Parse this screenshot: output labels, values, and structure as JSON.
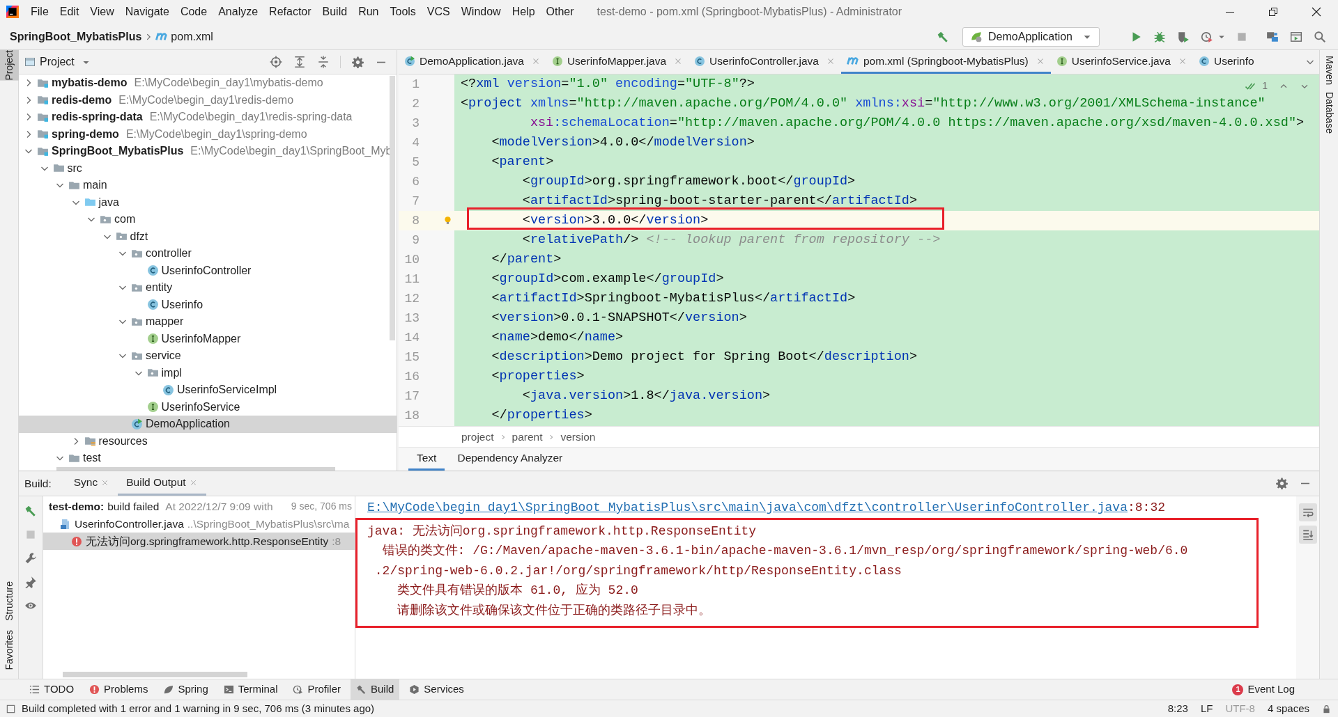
{
  "title_bar": {
    "menu": [
      "File",
      "Edit",
      "View",
      "Navigate",
      "Code",
      "Analyze",
      "Refactor",
      "Build",
      "Run",
      "Tools",
      "VCS",
      "Window",
      "Help",
      "Other"
    ],
    "title": "test-demo - pom.xml (Springboot-MybatisPlus) - Administrator"
  },
  "nav_bar": {
    "project": "SpringBoot_MybatisPlus",
    "file": "pom.xml",
    "run_config": "DemoApplication"
  },
  "left_strip": {
    "top": [
      {
        "label": "Project",
        "selected": true
      }
    ],
    "bottom": [
      {
        "label": "Structure",
        "selected": false
      },
      {
        "label": "Favorites",
        "selected": false
      }
    ]
  },
  "right_strip": [
    {
      "label": "Maven",
      "selected": false
    },
    {
      "label": "Database",
      "selected": false
    }
  ],
  "project_panel": {
    "title": "Project",
    "tree": [
      {
        "label": "mybatis-demo",
        "path": "E:\\MyCode\\begin_day1\\mybatis-demo",
        "kind": "module",
        "expanded": false,
        "selected": false
      },
      {
        "label": "redis-demo",
        "path": "E:\\MyCode\\begin_day1\\redis-demo",
        "kind": "module",
        "expanded": false,
        "selected": false
      },
      {
        "label": "redis-spring-data",
        "path": "E:\\MyCode\\begin_day1\\redis-spring-data",
        "kind": "module",
        "expanded": false,
        "selected": false
      },
      {
        "label": "spring-demo",
        "path": "E:\\MyCode\\begin_day1\\spring-demo",
        "kind": "module",
        "expanded": false,
        "selected": false
      },
      {
        "label": "SpringBoot_MybatisPlus",
        "path": "E:\\MyCode\\begin_day1\\SpringBoot_Myb",
        "kind": "module",
        "expanded": true,
        "selected": false,
        "children": [
          {
            "label": "src",
            "kind": "folder",
            "expanded": true,
            "selected": false,
            "children": [
              {
                "label": "main",
                "kind": "folder",
                "expanded": true,
                "selected": false,
                "children": [
                  {
                    "label": "java",
                    "kind": "source",
                    "expanded": true,
                    "selected": false,
                    "children": [
                      {
                        "label": "com",
                        "kind": "package",
                        "expanded": true,
                        "selected": false,
                        "children": [
                          {
                            "label": "dfzt",
                            "kind": "package",
                            "expanded": true,
                            "selected": false,
                            "children": [
                              {
                                "label": "controller",
                                "kind": "package",
                                "expanded": true,
                                "selected": false,
                                "children": [
                                  {
                                    "label": "UserinfoController",
                                    "kind": "class",
                                    "selected": false
                                  }
                                ]
                              },
                              {
                                "label": "entity",
                                "kind": "package",
                                "expanded": true,
                                "selected": false,
                                "children": [
                                  {
                                    "label": "Userinfo",
                                    "kind": "class",
                                    "selected": false
                                  }
                                ]
                              },
                              {
                                "label": "mapper",
                                "kind": "package",
                                "expanded": true,
                                "selected": false,
                                "children": [
                                  {
                                    "label": "UserinfoMapper",
                                    "kind": "interface",
                                    "selected": false
                                  }
                                ]
                              },
                              {
                                "label": "service",
                                "kind": "package",
                                "expanded": true,
                                "selected": false,
                                "children": [
                                  {
                                    "label": "impl",
                                    "kind": "package",
                                    "expanded": true,
                                    "selected": false,
                                    "children": [
                                      {
                                        "label": "UserinfoServiceImpl",
                                        "kind": "class",
                                        "selected": false
                                      }
                                    ]
                                  },
                                  {
                                    "label": "UserinfoService",
                                    "kind": "interface",
                                    "selected": false
                                  }
                                ]
                              },
                              {
                                "label": "DemoApplication",
                                "kind": "app",
                                "selected": true
                              }
                            ]
                          }
                        ]
                      }
                    ]
                  },
                  {
                    "label": "resources",
                    "kind": "resources",
                    "expanded": false,
                    "selected": false
                  }
                ]
              },
              {
                "label": "test",
                "kind": "folder",
                "expanded": true,
                "selected": false
              }
            ]
          }
        ]
      }
    ]
  },
  "editor": {
    "tabs": [
      {
        "label": "DemoApplication.java",
        "kind": "app",
        "selected": false,
        "closable": true
      },
      {
        "label": "UserinfoMapper.java",
        "kind": "interface",
        "selected": false,
        "closable": true
      },
      {
        "label": "UserinfoController.java",
        "kind": "class",
        "selected": false,
        "closable": true
      },
      {
        "label": "pom.xml (Springboot-MybatisPlus)",
        "kind": "maven",
        "selected": true,
        "closable": true
      },
      {
        "label": "UserinfoService.java",
        "kind": "interface",
        "selected": false,
        "closable": true
      },
      {
        "label": "Userinfo",
        "kind": "class",
        "selected": false,
        "closable": false
      }
    ],
    "inspection_count": "1",
    "lines": [
      {
        "number": "1",
        "highlighted": false,
        "tokens": [
          {
            "kind": "plain",
            "text": "<?"
          },
          {
            "kind": "tag",
            "text": "xml"
          },
          {
            "kind": "attr",
            "text": " version"
          },
          {
            "kind": "plain",
            "text": "="
          },
          {
            "kind": "value",
            "text": "\"1.0\""
          },
          {
            "kind": "attr",
            "text": " encoding"
          },
          {
            "kind": "plain",
            "text": "="
          },
          {
            "kind": "value",
            "text": "\"UTF-8\""
          },
          {
            "kind": "plain",
            "text": "?>"
          }
        ]
      },
      {
        "number": "2",
        "highlighted": false,
        "tokens": [
          {
            "kind": "plain",
            "text": "<"
          },
          {
            "kind": "tag",
            "text": "project"
          },
          {
            "kind": "attr",
            "text": " xmlns"
          },
          {
            "kind": "plain",
            "text": "="
          },
          {
            "kind": "value",
            "text": "\"http://maven.apache.org/POM/4.0.0\""
          },
          {
            "kind": "attr",
            "text": " xmlns:"
          },
          {
            "kind": "ns",
            "text": "xsi"
          },
          {
            "kind": "plain",
            "text": "="
          },
          {
            "kind": "value",
            "text": "\"http://www.w3.org/2001/XMLSchema-instance\""
          }
        ]
      },
      {
        "number": "3",
        "highlighted": false,
        "tokens": [
          {
            "kind": "ns",
            "text": "         xsi"
          },
          {
            "kind": "attr",
            "text": ":schemaLocation"
          },
          {
            "kind": "plain",
            "text": "="
          },
          {
            "kind": "value",
            "text": "\"http://maven.apache.org/POM/4.0.0 https://maven.apache.org/xsd/maven-4.0.0.xsd\""
          },
          {
            "kind": "plain",
            "text": ">"
          }
        ]
      },
      {
        "number": "4",
        "highlighted": false,
        "tokens": [
          {
            "kind": "plain",
            "text": "    <"
          },
          {
            "kind": "tag",
            "text": "modelVersion"
          },
          {
            "kind": "plain",
            "text": ">4.0.0</"
          },
          {
            "kind": "tag",
            "text": "modelVersion"
          },
          {
            "kind": "plain",
            "text": ">"
          }
        ]
      },
      {
        "number": "5",
        "highlighted": false,
        "tokens": [
          {
            "kind": "plain",
            "text": "    <"
          },
          {
            "kind": "tag",
            "text": "parent"
          },
          {
            "kind": "plain",
            "text": ">"
          }
        ]
      },
      {
        "number": "6",
        "highlighted": false,
        "tokens": [
          {
            "kind": "plain",
            "text": "        <"
          },
          {
            "kind": "tag",
            "text": "groupId"
          },
          {
            "kind": "plain",
            "text": ">org.springframework.boot</"
          },
          {
            "kind": "tag",
            "text": "groupId"
          },
          {
            "kind": "plain",
            "text": ">"
          }
        ]
      },
      {
        "number": "7",
        "highlighted": false,
        "tokens": [
          {
            "kind": "plain",
            "text": "        <"
          },
          {
            "kind": "tag",
            "text": "artifactId"
          },
          {
            "kind": "plain",
            "text": ">spring-boot-starter-parent</"
          },
          {
            "kind": "tag",
            "text": "artifactId"
          },
          {
            "kind": "plain",
            "text": ">"
          }
        ]
      },
      {
        "number": "8",
        "highlighted": true,
        "tokens": [
          {
            "kind": "plain",
            "text": "        <"
          },
          {
            "kind": "tag",
            "text": "version"
          },
          {
            "kind": "plain",
            "text": ">3.0.0</"
          },
          {
            "kind": "tag",
            "text": "version"
          },
          {
            "kind": "plain",
            "text": ">"
          }
        ]
      },
      {
        "number": "9",
        "highlighted": false,
        "tokens": [
          {
            "kind": "plain",
            "text": "        <"
          },
          {
            "kind": "tag",
            "text": "relativePath"
          },
          {
            "kind": "plain",
            "text": "/> "
          },
          {
            "kind": "comment",
            "text": "<!-- lookup parent from repository -->"
          }
        ]
      },
      {
        "number": "10",
        "highlighted": false,
        "tokens": [
          {
            "kind": "plain",
            "text": "    </"
          },
          {
            "kind": "tag",
            "text": "parent"
          },
          {
            "kind": "plain",
            "text": ">"
          }
        ]
      },
      {
        "number": "11",
        "highlighted": false,
        "tokens": [
          {
            "kind": "plain",
            "text": "    <"
          },
          {
            "kind": "tag",
            "text": "groupId"
          },
          {
            "kind": "plain",
            "text": ">com.example</"
          },
          {
            "kind": "tag",
            "text": "groupId"
          },
          {
            "kind": "plain",
            "text": ">"
          }
        ]
      },
      {
        "number": "12",
        "highlighted": false,
        "tokens": [
          {
            "kind": "plain",
            "text": "    <"
          },
          {
            "kind": "tag",
            "text": "artifactId"
          },
          {
            "kind": "plain",
            "text": ">Springboot-MybatisPlus</"
          },
          {
            "kind": "tag",
            "text": "artifactId"
          },
          {
            "kind": "plain",
            "text": ">"
          }
        ]
      },
      {
        "number": "13",
        "highlighted": false,
        "tokens": [
          {
            "kind": "plain",
            "text": "    <"
          },
          {
            "kind": "tag",
            "text": "version"
          },
          {
            "kind": "plain",
            "text": ">0.0.1-SNAPSHOT</"
          },
          {
            "kind": "tag",
            "text": "version"
          },
          {
            "kind": "plain",
            "text": ">"
          }
        ]
      },
      {
        "number": "14",
        "highlighted": false,
        "tokens": [
          {
            "kind": "plain",
            "text": "    <"
          },
          {
            "kind": "tag",
            "text": "name"
          },
          {
            "kind": "plain",
            "text": ">demo</"
          },
          {
            "kind": "tag",
            "text": "name"
          },
          {
            "kind": "plain",
            "text": ">"
          }
        ]
      },
      {
        "number": "15",
        "highlighted": false,
        "tokens": [
          {
            "kind": "plain",
            "text": "    <"
          },
          {
            "kind": "tag",
            "text": "description"
          },
          {
            "kind": "plain",
            "text": ">Demo project for Spring Boot</"
          },
          {
            "kind": "tag",
            "text": "description"
          },
          {
            "kind": "plain",
            "text": ">"
          }
        ]
      },
      {
        "number": "16",
        "highlighted": false,
        "tokens": [
          {
            "kind": "plain",
            "text": "    <"
          },
          {
            "kind": "tag",
            "text": "properties"
          },
          {
            "kind": "plain",
            "text": ">"
          }
        ]
      },
      {
        "number": "17",
        "highlighted": false,
        "tokens": [
          {
            "kind": "plain",
            "text": "        <"
          },
          {
            "kind": "tag",
            "text": "java.version"
          },
          {
            "kind": "plain",
            "text": ">1.8</"
          },
          {
            "kind": "tag",
            "text": "java.version"
          },
          {
            "kind": "plain",
            "text": ">"
          }
        ]
      },
      {
        "number": "18",
        "highlighted": false,
        "tokens": [
          {
            "kind": "plain",
            "text": "    </"
          },
          {
            "kind": "tag",
            "text": "properties"
          },
          {
            "kind": "plain",
            "text": ">"
          }
        ]
      }
    ],
    "breadcrumb": [
      "project",
      "parent",
      "version"
    ],
    "view_tabs": [
      {
        "label": "Text",
        "selected": true
      },
      {
        "label": "Dependency Analyzer",
        "selected": false
      }
    ]
  },
  "build": {
    "label": "Build:",
    "tabs": [
      {
        "label": "Sync",
        "selected": false
      },
      {
        "label": "Build Output",
        "selected": true
      }
    ],
    "tree": [
      {
        "kind": "summary",
        "title": "test-demo:",
        "status": "build failed",
        "time": "At 2022/12/7 9:09 with",
        "duration": "9 sec, 706 ms",
        "selected": false,
        "children": [
          {
            "kind": "file",
            "label": "UserinfoController.java",
            "path": "..\\SpringBoot_MybatisPlus\\src\\ma",
            "selected": false,
            "children": [
              {
                "kind": "error",
                "label": "无法访问org.springframework.http.ResponseEntity",
                "suffix": ":8",
                "selected": true
              }
            ]
          }
        ]
      }
    ],
    "console": {
      "link": "E:\\MyCode\\begin_day1\\SpringBoot_MybatisPlus\\src\\main\\java\\com\\dfzt\\controller\\UserinfoController.java",
      "link_suffix": ":8:32",
      "lines": [
        "java: 无法访问org.springframework.http.ResponseEntity",
        "  错误的类文件: /G:/Maven/apache-maven-3.6.1-bin/apache-maven-3.6.1/mvn_resp/org/springframework/spring-web/6.0",
        " .2/spring-web-6.0.2.jar!/org/springframework/http/ResponseEntity.class",
        "    类文件具有错误的版本 61.0, 应为 52.0",
        "    请删除该文件或确保该文件位于正确的类路径子目录中。"
      ]
    }
  },
  "tool_windows": [
    {
      "label": "TODO",
      "kind": "list",
      "selected": false
    },
    {
      "label": "Problems",
      "kind": "problems",
      "selected": false
    },
    {
      "label": "Spring",
      "kind": "leaf",
      "selected": false
    },
    {
      "label": "Terminal",
      "kind": "terminal",
      "selected": false
    },
    {
      "label": "Profiler",
      "kind": "profiler",
      "selected": false
    },
    {
      "label": "Build",
      "kind": "hammer",
      "selected": true
    },
    {
      "label": "Services",
      "kind": "services",
      "selected": false
    }
  ],
  "event_log": {
    "label": "Event Log",
    "count": "1"
  },
  "status_bar": {
    "message": "Build completed with 1 error and 1 warning in 9 sec, 706 ms (3 minutes ago)",
    "items": [
      {
        "text": "8:23",
        "dimmed": false
      },
      {
        "text": "LF",
        "dimmed": false
      },
      {
        "text": "UTF-8",
        "dimmed": true
      },
      {
        "text": "4 spaces",
        "dimmed": false
      }
    ]
  }
}
